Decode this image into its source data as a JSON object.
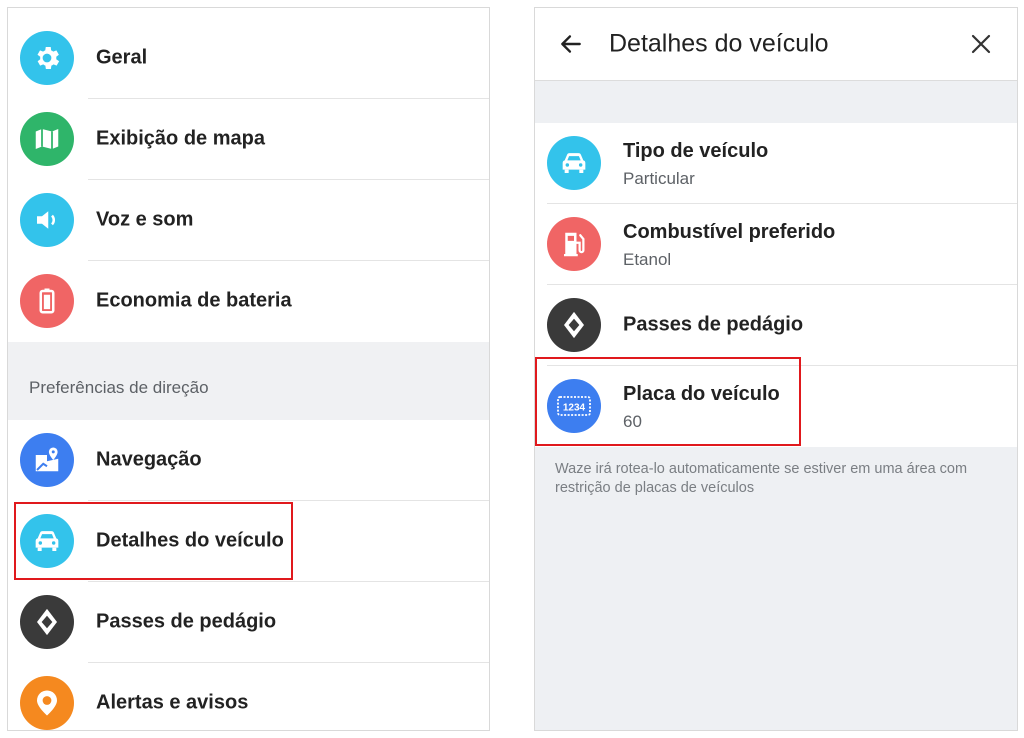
{
  "settings": {
    "items": [
      {
        "label": "Geral",
        "icon": "gear-icon",
        "color": "#33c3eb"
      },
      {
        "label": "Exibição de mapa",
        "icon": "map-icon",
        "color": "#2fb56a"
      },
      {
        "label": "Voz e som",
        "icon": "speaker-icon",
        "color": "#33c3eb"
      },
      {
        "label": "Economia de bateria",
        "icon": "battery-icon",
        "color": "#f06565"
      }
    ],
    "driving_section_title": "Preferências de direção",
    "driving_items": [
      {
        "label": "Navegação",
        "icon": "navigation-map-icon",
        "color": "#3d7ef0"
      },
      {
        "label": "Detalhes do veículo",
        "icon": "car-icon",
        "color": "#33c3eb",
        "highlighted": true
      },
      {
        "label": "Passes de pedágio",
        "icon": "toll-diamond-icon",
        "color": "#3a3a3a"
      },
      {
        "label": "Alertas e avisos",
        "icon": "alert-pin-icon",
        "color": "#f5891f"
      }
    ]
  },
  "vehicle_details": {
    "title": "Detalhes do veículo",
    "back_icon": "back-arrow-icon",
    "close_icon": "close-icon",
    "items": [
      {
        "label": "Tipo de veículo",
        "value": "Particular",
        "icon": "car-icon",
        "color": "#33c3eb"
      },
      {
        "label": "Combustível preferido",
        "value": "Etanol",
        "icon": "fuel-pump-icon",
        "color": "#f06565"
      },
      {
        "label": "Passes de pedágio",
        "icon": "toll-diamond-icon",
        "color": "#3a3a3a"
      },
      {
        "label": "Placa do veículo",
        "value": "60",
        "icon": "license-plate-icon",
        "plate_text": "1234",
        "color": "#3d7ef0",
        "highlighted": true
      }
    ],
    "footnote": "Waze irá rotea-lo automaticamente se estiver em uma área com restrição de placas de veículos"
  },
  "colors": {
    "highlight": "#e0191d",
    "section_bg": "#f0f1f3"
  }
}
